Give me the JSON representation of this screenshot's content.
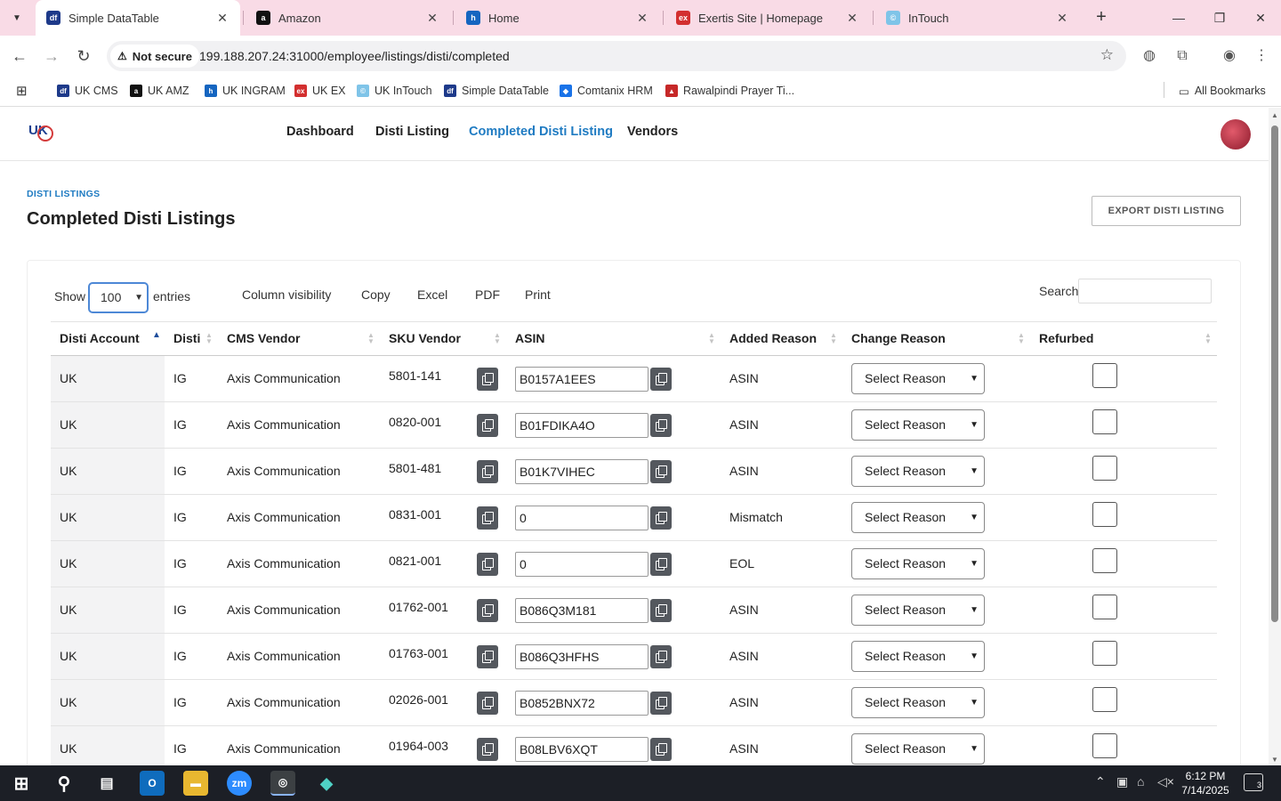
{
  "browser": {
    "tabs": [
      {
        "label": "Simple DataTable",
        "favicon": "df",
        "color": "#1e3a8a"
      },
      {
        "label": "Amazon",
        "favicon": "a",
        "color": "#111111"
      },
      {
        "label": "Home",
        "favicon": "h",
        "color": "#1565c0"
      },
      {
        "label": "Exertis Site | Homepage",
        "favicon": "ex",
        "color": "#d32f2f"
      },
      {
        "label": "InTouch",
        "favicon": "©",
        "color": "#7fc4e8"
      }
    ],
    "security_label": "Not secure",
    "url": "199.188.207.24:31000/employee/listings/disti/completed",
    "bookmarks": [
      {
        "label": "UK CMS",
        "color": "#1e3a8a",
        "favicon": "df"
      },
      {
        "label": "UK AMZ",
        "color": "#111111",
        "favicon": "a"
      },
      {
        "label": "UK INGRAM",
        "color": "#1565c0",
        "favicon": "h"
      },
      {
        "label": "UK EX",
        "color": "#d32f2f",
        "favicon": "ex"
      },
      {
        "label": "UK InTouch",
        "color": "#7fc4e8",
        "favicon": "©"
      },
      {
        "label": "Simple DataTable",
        "color": "#1e3a8a",
        "favicon": "df"
      },
      {
        "label": "Comtanix HRM",
        "color": "#1a73e8",
        "favicon": "◆"
      },
      {
        "label": "Rawalpindi Prayer Ti...",
        "color": "#c62828",
        "favicon": "▲"
      }
    ],
    "all_bookmarks": "All Bookmarks"
  },
  "app": {
    "logo": "UK",
    "nav": [
      {
        "label": "Dashboard",
        "active": false
      },
      {
        "label": "Disti Listing",
        "active": false
      },
      {
        "label": "Completed Disti Listing",
        "active": true
      },
      {
        "label": "Vendors",
        "active": false
      }
    ],
    "accent": "#1f7bc2"
  },
  "page": {
    "breadcrumb": "DISTI LISTINGS",
    "title": "Completed Disti Listings",
    "export_label": "EXPORT DISTI LISTING"
  },
  "datatable": {
    "show_label": "Show",
    "page_length": "100",
    "entries_label": "entries",
    "buttons": [
      "Column visibility",
      "Copy",
      "Excel",
      "PDF",
      "Print"
    ],
    "search_label": "Search",
    "search_value": "",
    "columns": [
      "Disti Account",
      "Disti",
      "CMS Vendor",
      "SKU Vendor",
      "ASIN",
      "Added Reason",
      "Change Reason",
      "Refurbed"
    ],
    "reason_placeholder": "Select Reason",
    "rows": [
      {
        "account": "UK",
        "disti": "IG",
        "vendor": "Axis Communication",
        "sku": "5801-141",
        "asin": "B0157A1EES",
        "added_reason": "ASIN",
        "refurbed": false
      },
      {
        "account": "UK",
        "disti": "IG",
        "vendor": "Axis Communication",
        "sku": "0820-001",
        "asin": "B01FDIKA4O",
        "added_reason": "ASIN",
        "refurbed": false
      },
      {
        "account": "UK",
        "disti": "IG",
        "vendor": "Axis Communication",
        "sku": "5801-481",
        "asin": "B01K7VIHEC",
        "added_reason": "ASIN",
        "refurbed": false
      },
      {
        "account": "UK",
        "disti": "IG",
        "vendor": "Axis Communication",
        "sku": "0831-001",
        "asin": "0",
        "added_reason": "Mismatch",
        "refurbed": false
      },
      {
        "account": "UK",
        "disti": "IG",
        "vendor": "Axis Communication",
        "sku": "0821-001",
        "asin": "0",
        "added_reason": "EOL",
        "refurbed": false
      },
      {
        "account": "UK",
        "disti": "IG",
        "vendor": "Axis Communication",
        "sku": "01762-001",
        "asin": "B086Q3M181",
        "added_reason": "ASIN",
        "refurbed": false
      },
      {
        "account": "UK",
        "disti": "IG",
        "vendor": "Axis Communication",
        "sku": "01763-001",
        "asin": "B086Q3HFHS",
        "added_reason": "ASIN",
        "refurbed": false
      },
      {
        "account": "UK",
        "disti": "IG",
        "vendor": "Axis Communication",
        "sku": "02026-001",
        "asin": "B0852BNX72",
        "added_reason": "ASIN",
        "refurbed": false
      },
      {
        "account": "UK",
        "disti": "IG",
        "vendor": "Axis Communication",
        "sku": "01964-003",
        "asin": "B08LBV6XQT",
        "added_reason": "ASIN",
        "refurbed": false
      }
    ]
  },
  "taskbar": {
    "time": "6:12 PM",
    "date": "7/14/2025",
    "notifications": "3"
  }
}
